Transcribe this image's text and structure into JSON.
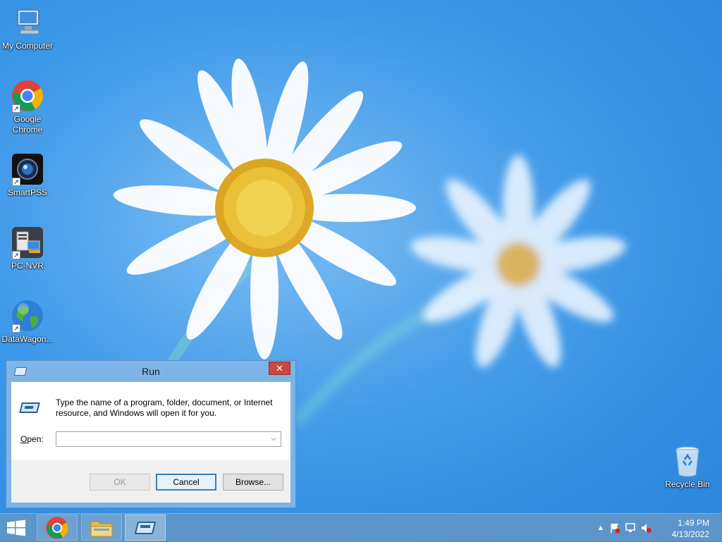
{
  "desktop": {
    "icons": [
      {
        "label": "My Computer"
      },
      {
        "label": "Google Chrome"
      },
      {
        "label": "SmartPSS"
      },
      {
        "label": "PC-NVR"
      },
      {
        "label": "DataWagon..."
      },
      {
        "label": "Recycle Bin"
      }
    ]
  },
  "run_dialog": {
    "title": "Run",
    "close_label": "✕",
    "description": "Type the name of a program, folder, document, or Internet resource, and Windows will open it for you.",
    "open_label_accel": "O",
    "open_label_rest": "pen:",
    "open_value": "",
    "open_placeholder": "",
    "ok_label": "OK",
    "cancel_label": "Cancel",
    "browse_label": "Browse..."
  },
  "taskbar": {
    "clock_time": "1:49 PM",
    "clock_date": "4/13/2022"
  },
  "colors": {
    "desktop_blue": "#3c98e8",
    "taskbar": "#5b95c9",
    "close_red": "#c7493f",
    "dialog_frame": "#7fb4e8"
  }
}
